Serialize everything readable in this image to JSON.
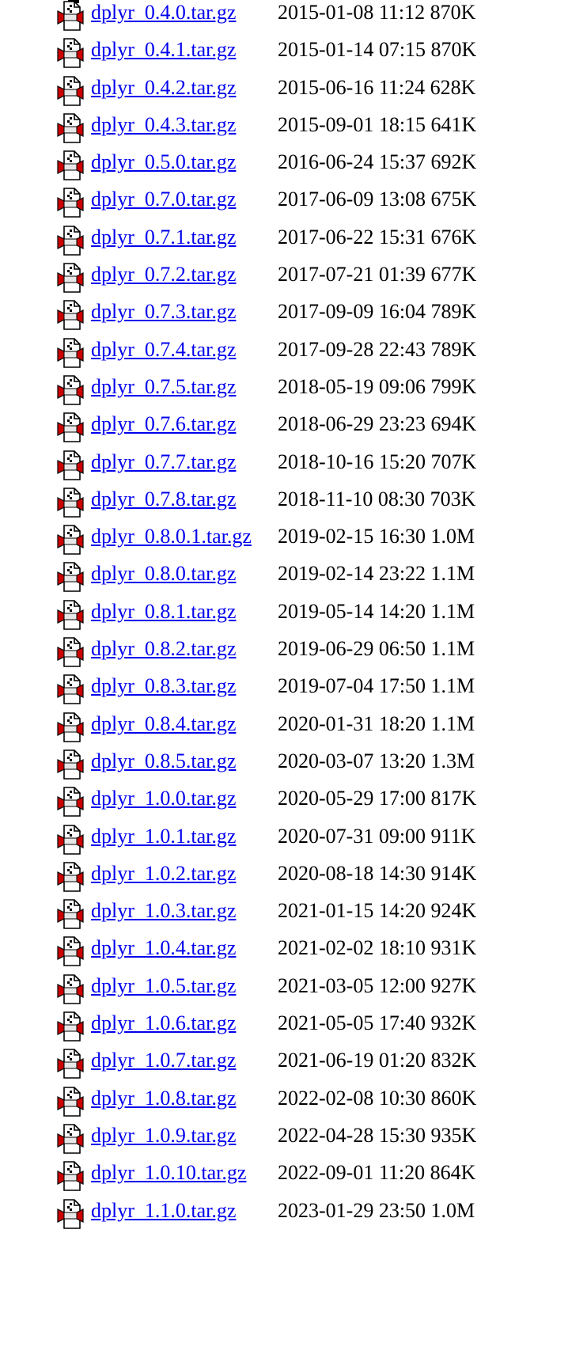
{
  "files": [
    {
      "name": "dplyr_0.4.0.tar.gz",
      "modified": "2015-01-08 11:12",
      "size": "870K"
    },
    {
      "name": "dplyr_0.4.1.tar.gz",
      "modified": "2015-01-14 07:15",
      "size": "870K"
    },
    {
      "name": "dplyr_0.4.2.tar.gz",
      "modified": "2015-06-16 11:24",
      "size": "628K"
    },
    {
      "name": "dplyr_0.4.3.tar.gz",
      "modified": "2015-09-01 18:15",
      "size": "641K"
    },
    {
      "name": "dplyr_0.5.0.tar.gz",
      "modified": "2016-06-24 15:37",
      "size": "692K"
    },
    {
      "name": "dplyr_0.7.0.tar.gz",
      "modified": "2017-06-09 13:08",
      "size": "675K"
    },
    {
      "name": "dplyr_0.7.1.tar.gz",
      "modified": "2017-06-22 15:31",
      "size": "676K"
    },
    {
      "name": "dplyr_0.7.2.tar.gz",
      "modified": "2017-07-21 01:39",
      "size": "677K"
    },
    {
      "name": "dplyr_0.7.3.tar.gz",
      "modified": "2017-09-09 16:04",
      "size": "789K"
    },
    {
      "name": "dplyr_0.7.4.tar.gz",
      "modified": "2017-09-28 22:43",
      "size": "789K"
    },
    {
      "name": "dplyr_0.7.5.tar.gz",
      "modified": "2018-05-19 09:06",
      "size": "799K"
    },
    {
      "name": "dplyr_0.7.6.tar.gz",
      "modified": "2018-06-29 23:23",
      "size": "694K"
    },
    {
      "name": "dplyr_0.7.7.tar.gz",
      "modified": "2018-10-16 15:20",
      "size": "707K"
    },
    {
      "name": "dplyr_0.7.8.tar.gz",
      "modified": "2018-11-10 08:30",
      "size": "703K"
    },
    {
      "name": "dplyr_0.8.0.1.tar.gz",
      "modified": "2019-02-15 16:30",
      "size": "1.0M"
    },
    {
      "name": "dplyr_0.8.0.tar.gz",
      "modified": "2019-02-14 23:22",
      "size": "1.1M"
    },
    {
      "name": "dplyr_0.8.1.tar.gz",
      "modified": "2019-05-14 14:20",
      "size": "1.1M"
    },
    {
      "name": "dplyr_0.8.2.tar.gz",
      "modified": "2019-06-29 06:50",
      "size": "1.1M"
    },
    {
      "name": "dplyr_0.8.3.tar.gz",
      "modified": "2019-07-04 17:50",
      "size": "1.1M"
    },
    {
      "name": "dplyr_0.8.4.tar.gz",
      "modified": "2020-01-31 18:20",
      "size": "1.1M"
    },
    {
      "name": "dplyr_0.8.5.tar.gz",
      "modified": "2020-03-07 13:20",
      "size": "1.3M"
    },
    {
      "name": "dplyr_1.0.0.tar.gz",
      "modified": "2020-05-29 17:00",
      "size": "817K"
    },
    {
      "name": "dplyr_1.0.1.tar.gz",
      "modified": "2020-07-31 09:00",
      "size": "911K"
    },
    {
      "name": "dplyr_1.0.2.tar.gz",
      "modified": "2020-08-18 14:30",
      "size": "914K"
    },
    {
      "name": "dplyr_1.0.3.tar.gz",
      "modified": "2021-01-15 14:20",
      "size": "924K"
    },
    {
      "name": "dplyr_1.0.4.tar.gz",
      "modified": "2021-02-02 18:10",
      "size": "931K"
    },
    {
      "name": "dplyr_1.0.5.tar.gz",
      "modified": "2021-03-05 12:00",
      "size": "927K"
    },
    {
      "name": "dplyr_1.0.6.tar.gz",
      "modified": "2021-05-05 17:40",
      "size": "932K"
    },
    {
      "name": "dplyr_1.0.7.tar.gz",
      "modified": "2021-06-19 01:20",
      "size": "832K"
    },
    {
      "name": "dplyr_1.0.8.tar.gz",
      "modified": "2022-02-08 10:30",
      "size": "860K"
    },
    {
      "name": "dplyr_1.0.9.tar.gz",
      "modified": "2022-04-28 15:30",
      "size": "935K"
    },
    {
      "name": "dplyr_1.0.10.tar.gz",
      "modified": "2022-09-01 11:20",
      "size": "864K"
    },
    {
      "name": "dplyr_1.1.0.tar.gz",
      "modified": "2023-01-29 23:50",
      "size": "1.0M"
    }
  ],
  "icon": "compressed-file-icon",
  "colors": {
    "link": "#0000ee",
    "text": "#000000",
    "background": "#ffffff",
    "icon_red": "#cc0000"
  }
}
